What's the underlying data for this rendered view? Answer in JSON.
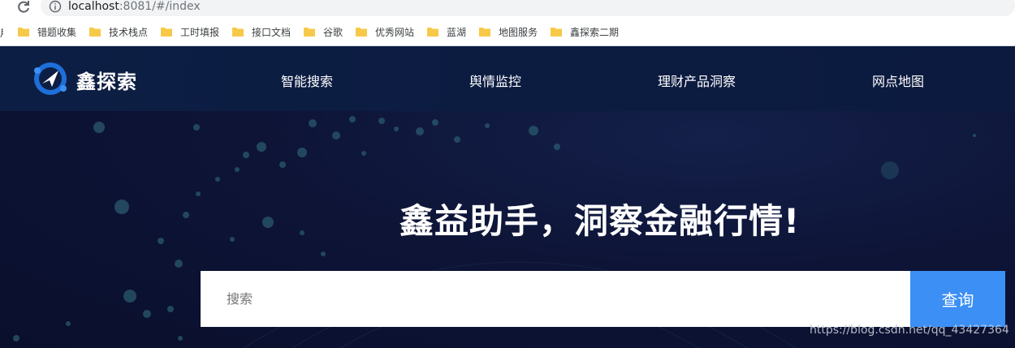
{
  "browser": {
    "url_host": "localhost",
    "url_rest": ":8081/#/index",
    "bookmarks": {
      "cut": "用",
      "items": [
        "错题收集",
        "技术栈点",
        "工时填报",
        "接口文档",
        "谷歌",
        "优秀网站",
        "蓝湖",
        "地图服务",
        "鑫探索二期"
      ]
    }
  },
  "header": {
    "logo_text": "鑫探索",
    "nav": [
      "智能搜索",
      "舆情监控",
      "理财产品洞察",
      "网点地图"
    ]
  },
  "hero": {
    "headline": "鑫益助手，洞察金融行情!",
    "search_placeholder": "搜索",
    "search_button": "查询"
  },
  "watermark": "https://blog.csdn.net/qq_43427364",
  "colors": {
    "accent": "#3b8ff5",
    "nav_bg": "#0d1e44",
    "hero_bg": "#0a0f2c"
  },
  "icons": [
    "reload-icon",
    "info-icon",
    "folder-icon",
    "logo-icon"
  ]
}
